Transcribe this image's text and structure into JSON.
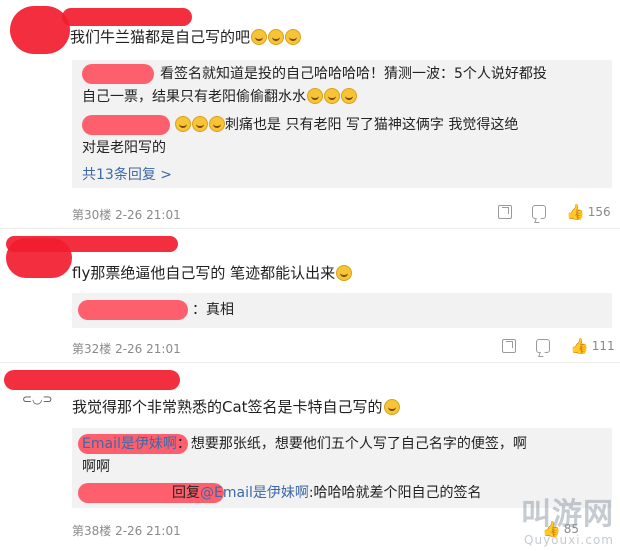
{
  "comments": [
    {
      "text": "我们牛兰猫都是自己写的吧",
      "replies": [
        {
          "text": "看签名就知道是投的自己哈哈哈哈！猜测一波：5个人说好都投"
        },
        {
          "text": "自己一票，结果只有老阳偷偷翻水水"
        },
        {
          "text": "刺痛也是  只有老阳  写了猫神这俩字  我觉得这绝"
        },
        {
          "text": "对是老阳写的"
        }
      ],
      "more": "共13条回复 >",
      "meta": "第30楼  2-26 21:01",
      "likes": "156"
    },
    {
      "text": "fly那票绝逼他自己写的  笔迹都能认出来",
      "replies": [
        {
          "text": "真相"
        }
      ],
      "meta": "第32楼  2-26 21:01",
      "likes": "111"
    },
    {
      "text": "我觉得那个非常熟悉的Cat签名是卡特自己写的",
      "replies": [
        {
          "name": "Email是伊妹啊",
          "text": "：想要那张纸，想要他们五个人写了自己名字的便签，啊"
        },
        {
          "text": "啊啊"
        },
        {
          "pre": "回复",
          "name": "@Email是伊妹啊",
          "text": ":哈哈哈就差个阳自己的签名"
        }
      ],
      "meta": "第38楼  2-26 21:01",
      "likes": "85"
    }
  ],
  "watermark": {
    "big": "叫游网",
    "small": "Quyouxi.com"
  },
  "colors": {
    "redaction": "#f21d2f",
    "link": "#3d69a6",
    "reply_bg": "#f2f2f2"
  }
}
